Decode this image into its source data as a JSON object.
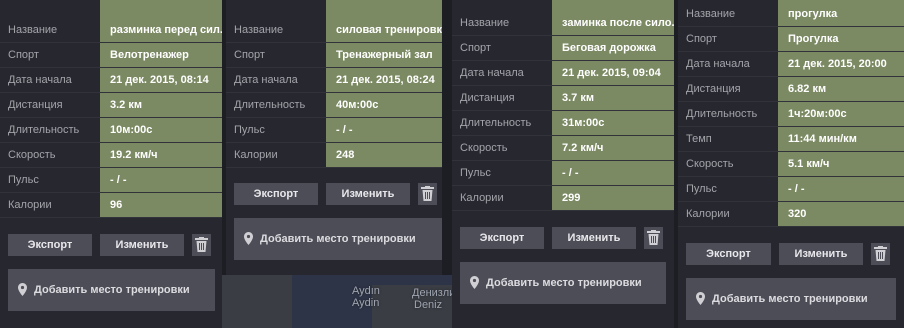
{
  "buttons": {
    "export": "Экспорт",
    "edit": "Изменить",
    "add_place": "Добавить место тренировки"
  },
  "cards": [
    {
      "rows": [
        {
          "label": "Название",
          "value": "разминка перед сил..."
        },
        {
          "label": "Спорт",
          "value": "Велотренажер"
        },
        {
          "label": "Дата начала",
          "value": "21 дек. 2015, 08:14"
        },
        {
          "label": "Дистанция",
          "value": "3.2 км"
        },
        {
          "label": "Длительность",
          "value": "10м:00с"
        },
        {
          "label": "Скорость",
          "value": "19.2 км/ч"
        },
        {
          "label": "Пульс",
          "value": "- / -"
        },
        {
          "label": "Калории",
          "value": "96"
        }
      ]
    },
    {
      "rows": [
        {
          "label": "Название",
          "value": "силовая тренировка"
        },
        {
          "label": "Спорт",
          "value": "Тренажерный зал"
        },
        {
          "label": "Дата начала",
          "value": "21 дек. 2015, 08:24"
        },
        {
          "label": "Длительность",
          "value": "40м:00с"
        },
        {
          "label": "Пульс",
          "value": "- / -"
        },
        {
          "label": "Калории",
          "value": "248"
        }
      ]
    },
    {
      "rows": [
        {
          "label": "Название",
          "value": "заминка после сило..."
        },
        {
          "label": "Спорт",
          "value": "Беговая дорожка"
        },
        {
          "label": "Дата начала",
          "value": "21 дек. 2015, 09:04"
        },
        {
          "label": "Дистанция",
          "value": "3.7 км"
        },
        {
          "label": "Длительность",
          "value": "31м:00с"
        },
        {
          "label": "Скорость",
          "value": "7.2 км/ч"
        },
        {
          "label": "Пульс",
          "value": "- / -"
        },
        {
          "label": "Калории",
          "value": "299"
        }
      ]
    },
    {
      "rows": [
        {
          "label": "Название",
          "value": "прогулка"
        },
        {
          "label": "Спорт",
          "value": "Прогулка"
        },
        {
          "label": "Дата начала",
          "value": "21 дек. 2015, 20:00"
        },
        {
          "label": "Дистанция",
          "value": "6.82 км"
        },
        {
          "label": "Длительность",
          "value": "1ч:20м:00с"
        },
        {
          "label": "Темп",
          "value": "11:44 мин/км"
        },
        {
          "label": "Скорость",
          "value": "5.1 км/ч"
        },
        {
          "label": "Пульс",
          "value": "- / -"
        },
        {
          "label": "Калории",
          "value": "320"
        }
      ]
    }
  ],
  "map": {
    "labels": [
      "Aydın",
      "Aydin",
      "Денизли",
      "Deniz"
    ]
  },
  "colors": {
    "value_bg": "#7b8a63",
    "card_bg": "#27272f",
    "button_bg": "#4d4d57"
  }
}
